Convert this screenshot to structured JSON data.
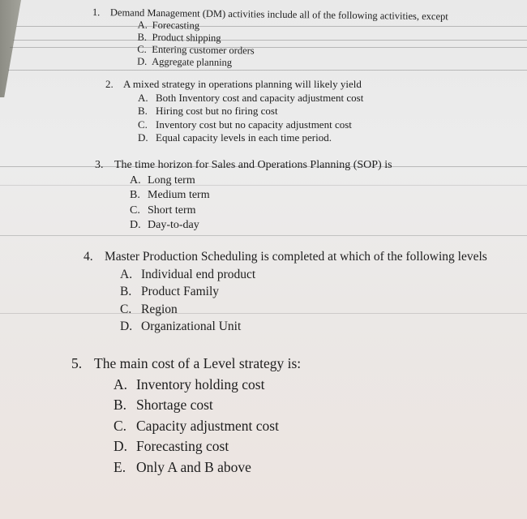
{
  "document": {
    "questions": [
      {
        "number": "1.",
        "text": "Demand Management (DM) activities include all of the following activities, except",
        "options": [
          {
            "letter": "A.",
            "text": "Forecasting"
          },
          {
            "letter": "B.",
            "text": "Product shipping"
          },
          {
            "letter": "C.",
            "text": "Entering customer orders"
          },
          {
            "letter": "D.",
            "text": "Aggregate planning"
          }
        ]
      },
      {
        "number": "2.",
        "text": "A mixed strategy in operations planning will likely yield",
        "options": [
          {
            "letter": "A.",
            "text": "Both Inventory cost and capacity adjustment cost"
          },
          {
            "letter": "B.",
            "text": "Hiring cost but no firing cost"
          },
          {
            "letter": "C.",
            "text": "Inventory cost but no capacity adjustment cost"
          },
          {
            "letter": "D.",
            "text": "Equal capacity levels in each time period."
          }
        ]
      },
      {
        "number": "3.",
        "text": "The time horizon for Sales and Operations Planning (SOP) is",
        "options": [
          {
            "letter": "A.",
            "text": "Long term"
          },
          {
            "letter": "B.",
            "text": "Medium term"
          },
          {
            "letter": "C.",
            "text": "Short term"
          },
          {
            "letter": "D.",
            "text": "Day-to-day"
          }
        ]
      },
      {
        "number": "4.",
        "text": "Master Production Scheduling is completed at which of the following levels",
        "options": [
          {
            "letter": "A.",
            "text": "Individual end product"
          },
          {
            "letter": "B.",
            "text": "Product Family"
          },
          {
            "letter": "C.",
            "text": "Region"
          },
          {
            "letter": "D.",
            "text": "Organizational Unit"
          }
        ]
      },
      {
        "number": "5.",
        "text": "The main cost of a Level strategy is:",
        "options": [
          {
            "letter": "A.",
            "text": "Inventory holding cost"
          },
          {
            "letter": "B.",
            "text": "Shortage cost"
          },
          {
            "letter": "C.",
            "text": "Capacity adjustment cost"
          },
          {
            "letter": "D.",
            "text": "Forecasting cost"
          },
          {
            "letter": "E.",
            "text": "Only A and B above"
          }
        ]
      }
    ]
  }
}
